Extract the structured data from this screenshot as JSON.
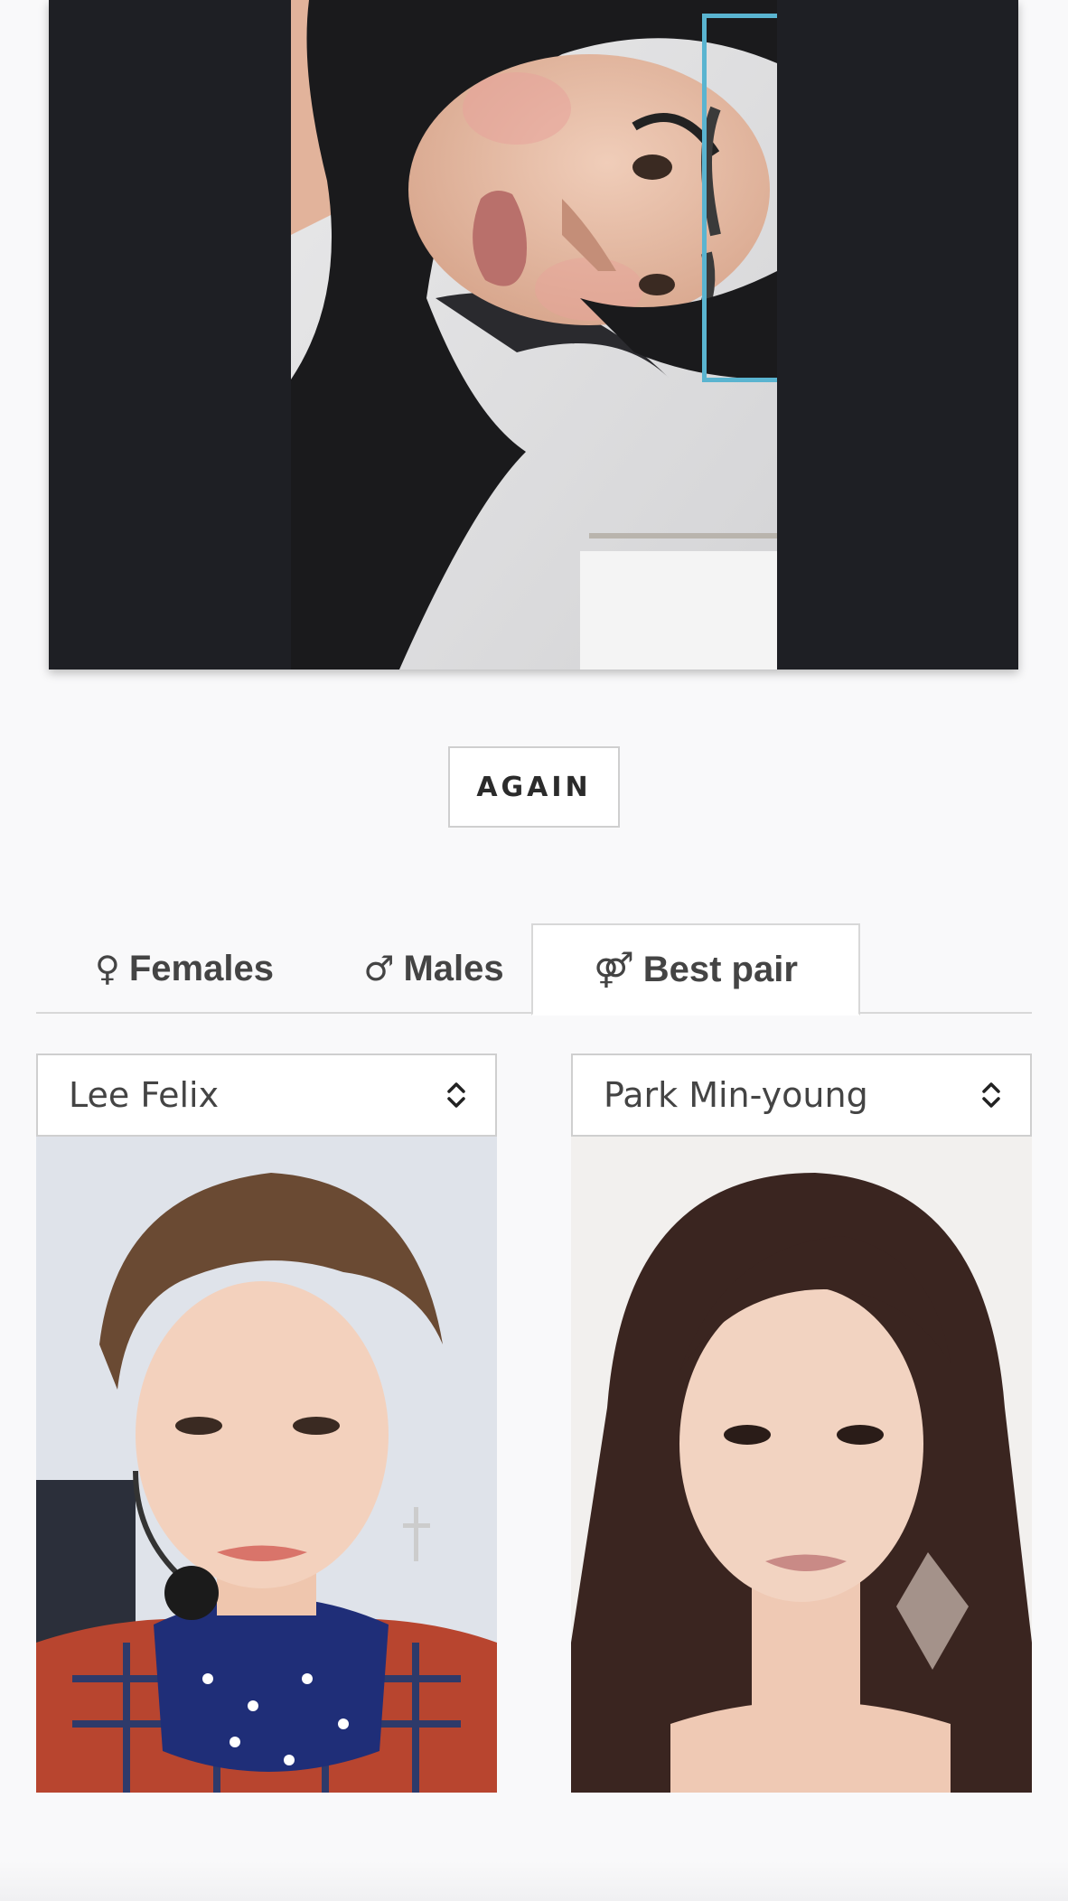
{
  "actions": {
    "again_label": "AGAIN"
  },
  "tabs": [
    {
      "symbol": "♀",
      "label": "Females",
      "active": false
    },
    {
      "symbol": "♂",
      "label": "Males",
      "active": false
    },
    {
      "symbol": "⚤",
      "label": "Best pair",
      "active": true
    }
  ],
  "pair": {
    "left_select": {
      "value": "Lee Felix"
    },
    "right_select": {
      "value": "Park Min-young"
    }
  },
  "colors": {
    "face_box": "#5ab4d0",
    "photo_panel_bg": "#1e1f24",
    "page_bg": "#f9f9fa"
  },
  "icons": {
    "select_chevron": "chevron-up-down-icon",
    "face_detection": "face-bounding-box"
  }
}
